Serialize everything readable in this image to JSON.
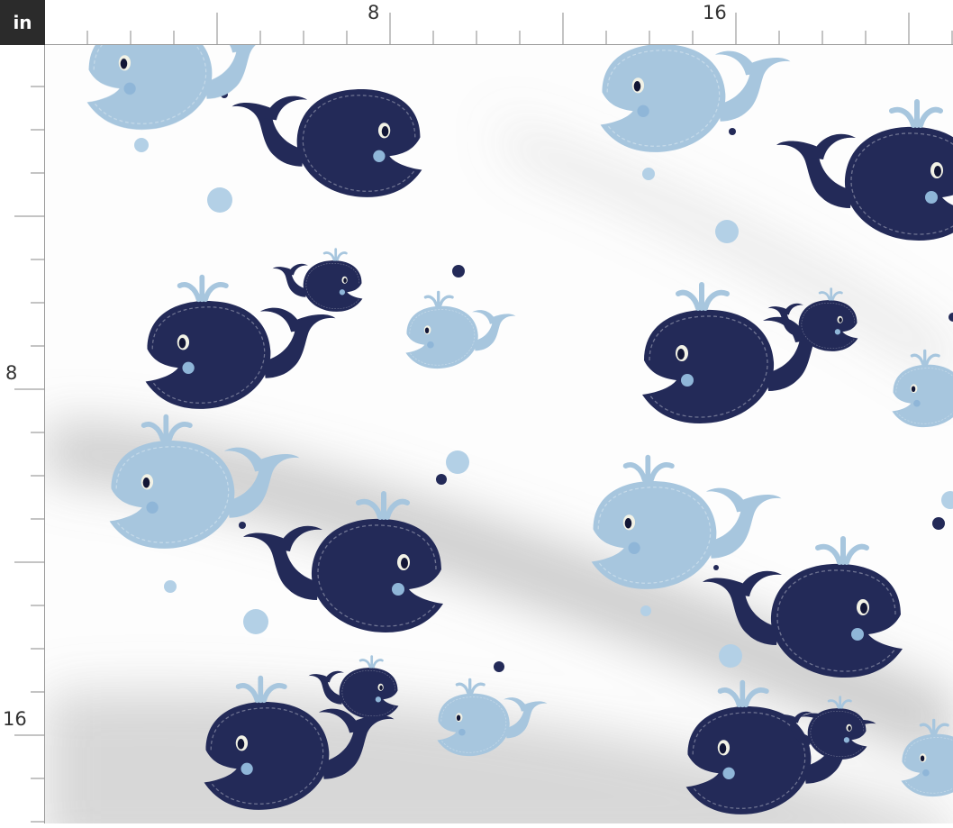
{
  "ruler": {
    "unit_label": "in",
    "top_labels": [
      "8",
      "16"
    ],
    "left_labels": [
      "8",
      "16"
    ]
  },
  "fabric": {
    "pattern": "whales",
    "colors": {
      "navy": "#232a58",
      "light_blue": "#a7c6de",
      "bubble": "#b3d0e6",
      "shade": "#8e8e8e"
    }
  }
}
